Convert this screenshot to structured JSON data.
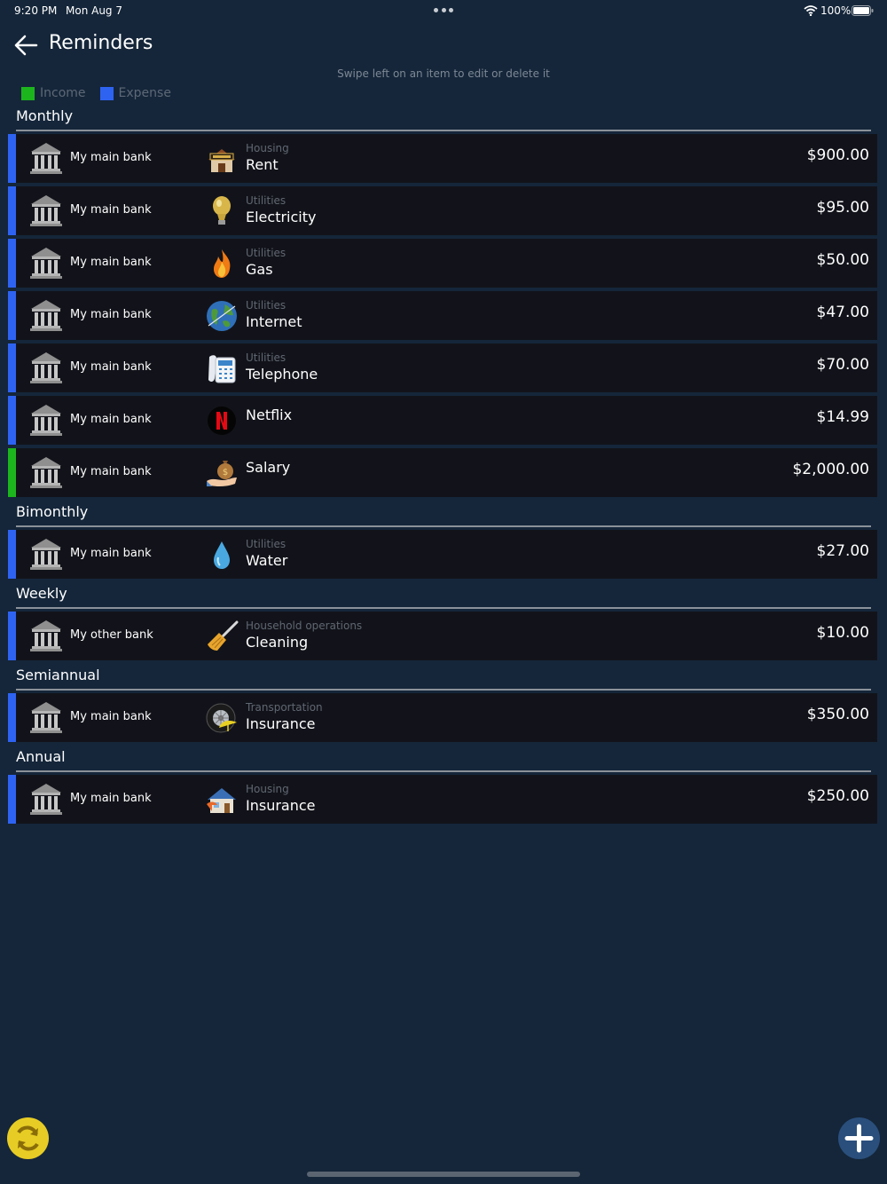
{
  "status_bar": {
    "time": "9:20 PM",
    "date": "Mon Aug 7",
    "battery": "100%"
  },
  "header": {
    "title": "Reminders"
  },
  "hint": "Swipe left on an item to edit or delete it",
  "legend": {
    "income": {
      "label": "Income",
      "color": "#1db51d"
    },
    "expense": {
      "label": "Expense",
      "color": "#2e63f2"
    }
  },
  "sections": [
    {
      "title": "Monthly",
      "items": [
        {
          "account": "My main bank",
          "group": "Housing",
          "category": "Rent",
          "amount": "$900.00",
          "type": "expense",
          "icon": "house-for-rent-icon"
        },
        {
          "account": "My main bank",
          "group": "Utilities",
          "category": "Electricity",
          "amount": "$95.00",
          "type": "expense",
          "icon": "light-bulb-icon"
        },
        {
          "account": "My main bank",
          "group": "Utilities",
          "category": "Gas",
          "amount": "$50.00",
          "type": "expense",
          "icon": "flame-icon"
        },
        {
          "account": "My main bank",
          "group": "Utilities",
          "category": "Internet",
          "amount": "$47.00",
          "type": "expense",
          "icon": "globe-icon"
        },
        {
          "account": "My main bank",
          "group": "Utilities",
          "category": "Telephone",
          "amount": "$70.00",
          "type": "expense",
          "icon": "telephone-icon"
        },
        {
          "account": "My main bank",
          "group": "",
          "category": "Netflix",
          "amount": "$14.99",
          "type": "expense",
          "icon": "netflix-icon"
        },
        {
          "account": "My main bank",
          "group": "",
          "category": "Salary",
          "amount": "$2,000.00",
          "type": "income",
          "icon": "money-bag-hand-icon"
        }
      ]
    },
    {
      "title": "Bimonthly",
      "items": [
        {
          "account": "My main bank",
          "group": "Utilities",
          "category": "Water",
          "amount": "$27.00",
          "type": "expense",
          "icon": "water-drop-icon"
        }
      ]
    },
    {
      "title": "Weekly",
      "items": [
        {
          "account": "My other bank",
          "group": "Household operations",
          "category": "Cleaning",
          "amount": "$10.00",
          "type": "expense",
          "icon": "broom-icon"
        }
      ]
    },
    {
      "title": "Semiannual",
      "items": [
        {
          "account": "My main bank",
          "group": "Transportation",
          "category": "Insurance",
          "amount": "$350.00",
          "type": "expense",
          "icon": "car-wheel-umbrella-icon"
        }
      ]
    },
    {
      "title": "Annual",
      "items": [
        {
          "account": "My main bank",
          "group": "Housing",
          "category": "Insurance",
          "amount": "$250.00",
          "type": "expense",
          "icon": "house-insurance-icon"
        }
      ]
    }
  ],
  "actions": {
    "sync_icon": "sync-icon",
    "add_icon": "plus-icon"
  }
}
